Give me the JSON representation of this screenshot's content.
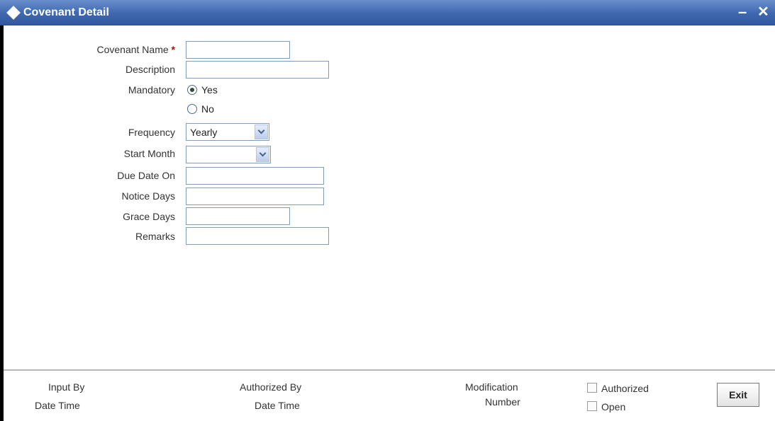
{
  "window": {
    "title": "Covenant Detail",
    "minimize_label": "–",
    "close_label": "✕"
  },
  "form": {
    "covenant_name": {
      "label": "Covenant Name",
      "required_mark": "*",
      "value": ""
    },
    "description": {
      "label": "Description",
      "value": ""
    },
    "mandatory": {
      "label": "Mandatory",
      "options": [
        "Yes",
        "No"
      ],
      "selected": "Yes"
    },
    "frequency": {
      "label": "Frequency",
      "value": "Yearly"
    },
    "start_month": {
      "label": "Start Month",
      "value": ""
    },
    "due_date_on": {
      "label": "Due Date On",
      "value": ""
    },
    "notice_days": {
      "label": "Notice Days",
      "value": ""
    },
    "grace_days": {
      "label": "Grace Days",
      "value": ""
    },
    "remarks": {
      "label": "Remarks",
      "value": ""
    }
  },
  "footer": {
    "input_by": "Input By",
    "date_time_1": "Date Time",
    "authorized_by": "Authorized By",
    "date_time_2": "Date Time",
    "modification": "Modification",
    "number": "Number",
    "authorized_checkbox": {
      "label": "Authorized",
      "checked": false
    },
    "open_checkbox": {
      "label": "Open",
      "checked": false
    },
    "exit_label": "Exit"
  }
}
